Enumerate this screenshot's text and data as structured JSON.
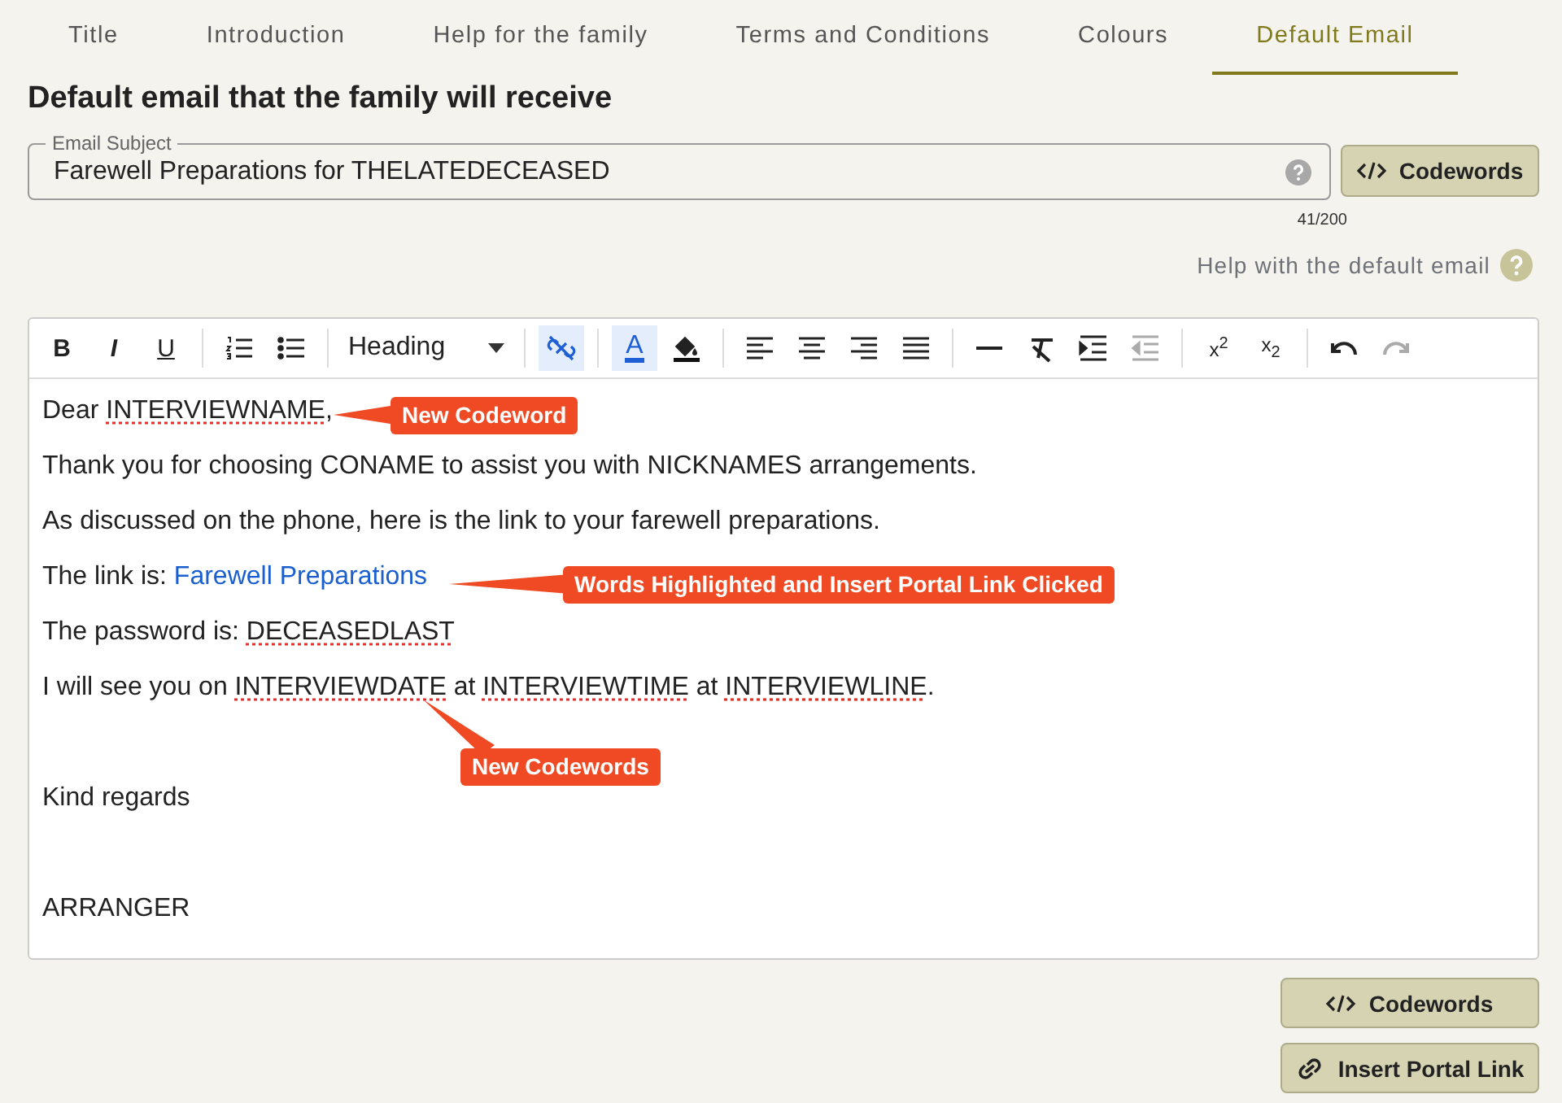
{
  "tabs": [
    {
      "label": "Title",
      "selected": false
    },
    {
      "label": "Introduction",
      "selected": false
    },
    {
      "label": "Help for the family",
      "selected": false
    },
    {
      "label": "Terms and Conditions",
      "selected": false
    },
    {
      "label": "Colours",
      "selected": false
    },
    {
      "label": "Default Email",
      "selected": true
    }
  ],
  "heading": "Default email that the family will receive",
  "subject": {
    "label": "Email Subject",
    "value": "Farewell Preparations for THELATEDECEASED",
    "counter": "41/200",
    "button": "Codewords"
  },
  "help_link": "Help with the default email",
  "toolbar": [
    {
      "kind": "glyph",
      "label": "B",
      "active": false,
      "disabled": false
    },
    {
      "kind": "glyph",
      "label": "I",
      "active": false,
      "disabled": false
    },
    {
      "kind": "glyph",
      "label": "U",
      "active": false,
      "disabled": false
    },
    {
      "kind": "sep"
    },
    {
      "kind": "icon",
      "active": false,
      "disabled": false
    },
    {
      "kind": "icon",
      "active": false,
      "disabled": false
    },
    {
      "kind": "sep"
    },
    {
      "kind": "select",
      "label": "Heading"
    },
    {
      "kind": "sep"
    },
    {
      "kind": "icon",
      "active": true,
      "disabled": false
    },
    {
      "kind": "sep"
    },
    {
      "kind": "glyph",
      "label": "A",
      "active": true,
      "disabled": false
    },
    {
      "kind": "icon",
      "active": false,
      "disabled": false
    },
    {
      "kind": "sep"
    },
    {
      "kind": "icon",
      "active": false,
      "disabled": false
    },
    {
      "kind": "icon",
      "active": false,
      "disabled": false
    },
    {
      "kind": "icon",
      "active": false,
      "disabled": false
    },
    {
      "kind": "icon",
      "active": false,
      "disabled": false
    },
    {
      "kind": "sep"
    },
    {
      "kind": "icon",
      "active": false,
      "disabled": false
    },
    {
      "kind": "icon",
      "active": false,
      "disabled": false
    },
    {
      "kind": "icon",
      "active": false,
      "disabled": false
    },
    {
      "kind": "icon",
      "active": false,
      "disabled": true
    },
    {
      "kind": "sep"
    },
    {
      "kind": "glyph",
      "label": "x$^{2}$",
      "active": false,
      "disabled": false
    },
    {
      "kind": "glyph",
      "label": "x$_{2}$",
      "active": false,
      "disabled": false
    },
    {
      "kind": "sep"
    },
    {
      "kind": "icon",
      "active": false,
      "disabled": false
    },
    {
      "kind": "icon",
      "active": false,
      "disabled": true
    }
  ],
  "paragraphs": [
    {
      "segments": [
        {
          "kind": "plain",
          "text": "Dear "
        },
        {
          "kind": "codeword",
          "text": "INTERVIEWNAME"
        },
        {
          "kind": "plain",
          "text": ","
        }
      ]
    },
    {
      "segments": [
        {
          "kind": "plain",
          "text": "Thank you for choosing CONAME to assist you with NICKNAMES arrangements."
        }
      ]
    },
    {
      "segments": [
        {
          "kind": "plain",
          "text": "As discussed on the phone, here is the link to your farewell preparations."
        }
      ]
    },
    {
      "segments": [
        {
          "kind": "plain",
          "text": "The link is: "
        },
        {
          "kind": "link",
          "text": "Farewell Preparations"
        }
      ]
    },
    {
      "segments": [
        {
          "kind": "plain",
          "text": "The password is: "
        },
        {
          "kind": "codeword",
          "text": "DECEASEDLAST"
        }
      ]
    },
    {
      "segments": [
        {
          "kind": "plain",
          "text": "I will see you on "
        },
        {
          "kind": "codeword",
          "text": "INTERVIEWDATE"
        },
        {
          "kind": "plain",
          "text": " at "
        },
        {
          "kind": "codeword",
          "text": "INTERVIEWTIME"
        },
        {
          "kind": "plain",
          "text": " at "
        },
        {
          "kind": "codeword",
          "text": "INTERVIEWLINE"
        },
        {
          "kind": "plain",
          "text": "."
        }
      ]
    },
    {
      "segments": [
        {
          "kind": "plain",
          "text": "Kind regards"
        }
      ]
    },
    {
      "segments": [
        {
          "kind": "plain",
          "text": "ARRANGER"
        }
      ]
    }
  ],
  "annotations": [
    {
      "text": "New Codeword"
    },
    {
      "text": "Words Highlighted and Insert Portal Link Clicked"
    },
    {
      "text": "New Codewords"
    }
  ],
  "buttons": [
    {
      "kind": "code",
      "label": "Codewords"
    },
    {
      "kind": "link",
      "label": "Insert Portal Link"
    }
  ]
}
